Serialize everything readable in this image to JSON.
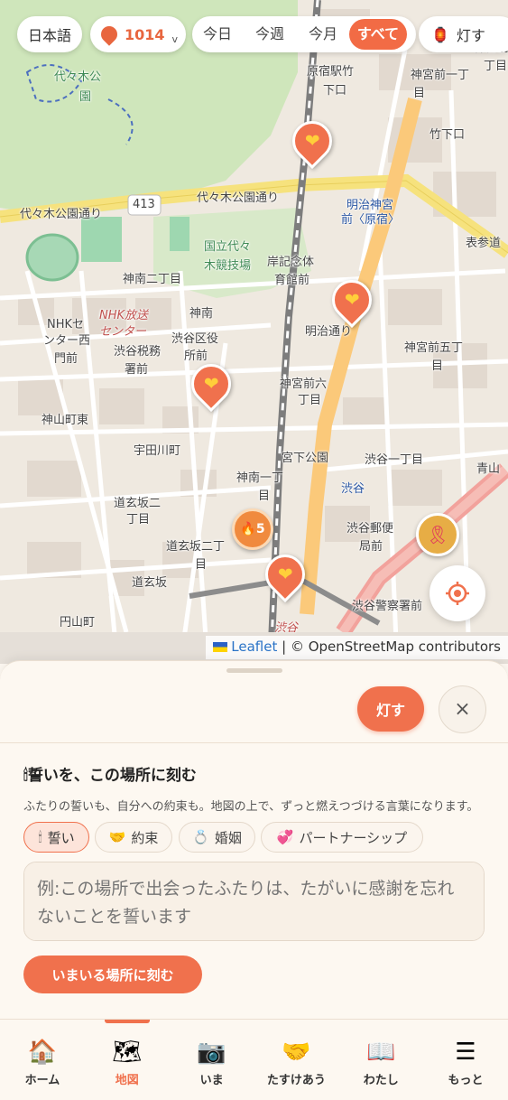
{
  "topbar": {
    "language": "日本語",
    "count": "1014",
    "count_chevron": "v",
    "filters": [
      "今日",
      "今週",
      "今月",
      "すべて"
    ],
    "active_filter": "すべて",
    "light_label": "灯す"
  },
  "map": {
    "labels": [
      {
        "text": "代々木公",
        "cls": "green"
      },
      {
        "text": "園",
        "cls": "green"
      },
      {
        "text": "原宿駅竹",
        "cls": ""
      },
      {
        "text": "下口",
        "cls": ""
      },
      {
        "text": "神宮前一丁",
        "cls": ""
      },
      {
        "text": "目",
        "cls": ""
      },
      {
        "text": "神宮前",
        "cls": ""
      },
      {
        "text": "丁目",
        "cls": ""
      },
      {
        "text": "竹下口",
        "cls": ""
      },
      {
        "text": "明治神宮",
        "cls": "blue"
      },
      {
        "text": "前〈原宿〉",
        "cls": "blue"
      },
      {
        "text": "代々木公園通り",
        "cls": ""
      },
      {
        "text": "代々木公園通り",
        "cls": ""
      },
      {
        "text": "413",
        "cls": ""
      },
      {
        "text": "国立代々",
        "cls": "green"
      },
      {
        "text": "木競技場",
        "cls": "green"
      },
      {
        "text": "岸記念体",
        "cls": ""
      },
      {
        "text": "育館前",
        "cls": ""
      },
      {
        "text": "神南二丁目",
        "cls": ""
      },
      {
        "text": "NHKセ",
        "cls": ""
      },
      {
        "text": "ンター西",
        "cls": ""
      },
      {
        "text": "門前",
        "cls": ""
      },
      {
        "text": "NHK放送",
        "cls": "italic"
      },
      {
        "text": "センター",
        "cls": "italic"
      },
      {
        "text": "渋谷区役",
        "cls": ""
      },
      {
        "text": "所前",
        "cls": ""
      },
      {
        "text": "渋谷税務",
        "cls": ""
      },
      {
        "text": "署前",
        "cls": ""
      },
      {
        "text": "神南",
        "cls": ""
      },
      {
        "text": "神宮前六",
        "cls": ""
      },
      {
        "text": "丁目",
        "cls": ""
      },
      {
        "text": "神宮前五丁",
        "cls": ""
      },
      {
        "text": "目",
        "cls": ""
      },
      {
        "text": "神山町東",
        "cls": ""
      },
      {
        "text": "宇田川町",
        "cls": ""
      },
      {
        "text": "宮下公園",
        "cls": ""
      },
      {
        "text": "渋谷一丁目",
        "cls": ""
      },
      {
        "text": "神南一丁",
        "cls": ""
      },
      {
        "text": "目",
        "cls": ""
      },
      {
        "text": "渋谷",
        "cls": "blue"
      },
      {
        "text": "道玄坂二",
        "cls": ""
      },
      {
        "text": "丁目",
        "cls": ""
      },
      {
        "text": "渋谷郵便",
        "cls": ""
      },
      {
        "text": "局前",
        "cls": ""
      },
      {
        "text": "道玄坂二丁",
        "cls": ""
      },
      {
        "text": "目",
        "cls": ""
      },
      {
        "text": "道玄坂",
        "cls": ""
      },
      {
        "text": "円山町",
        "cls": ""
      },
      {
        "text": "渋谷警察署前",
        "cls": ""
      },
      {
        "text": "青山",
        "cls": ""
      },
      {
        "text": "表参道",
        "cls": ""
      },
      {
        "text": "明治通り",
        "cls": ""
      },
      {
        "text": "渋谷",
        "cls": "italic"
      }
    ],
    "cluster_count": "5",
    "attribution_leaflet": "Leaflet",
    "attribution_rest": "| © OpenStreetMap contributors"
  },
  "sheet": {
    "light_button": "灯す",
    "close_button": "×",
    "title": "誓いを、この場所に刻む",
    "description": "ふたりの誓いも、自分への約束も。地図の上で、ずっと燃えつづける言葉になります。",
    "chips": [
      {
        "icon": "🕯",
        "label": "誓い"
      },
      {
        "icon": "🤝",
        "label": "約束"
      },
      {
        "icon": "💍",
        "label": "婚姻"
      },
      {
        "icon": "💞",
        "label": "パートナーシップ"
      }
    ],
    "selected_chip": "誓い",
    "input_placeholder": "例:この場所で出会ったふたりは、たがいに感謝を忘れないことを誓います",
    "submit_button": "いまいる場所に刻む"
  },
  "nav": {
    "items": [
      {
        "icon": "🏠",
        "label": "ホーム"
      },
      {
        "icon": "🗺",
        "label": "地図"
      },
      {
        "icon": "📷",
        "label": "いま"
      },
      {
        "icon": "🤝",
        "label": "たすけあう"
      },
      {
        "icon": "📖",
        "label": "わたし"
      },
      {
        "icon": "☰",
        "label": "もっと"
      }
    ],
    "active": "地図"
  },
  "colors": {
    "accent": "#f0714d",
    "map_bg": "#efe9e0",
    "sheet_bg": "#fdf8f1"
  }
}
